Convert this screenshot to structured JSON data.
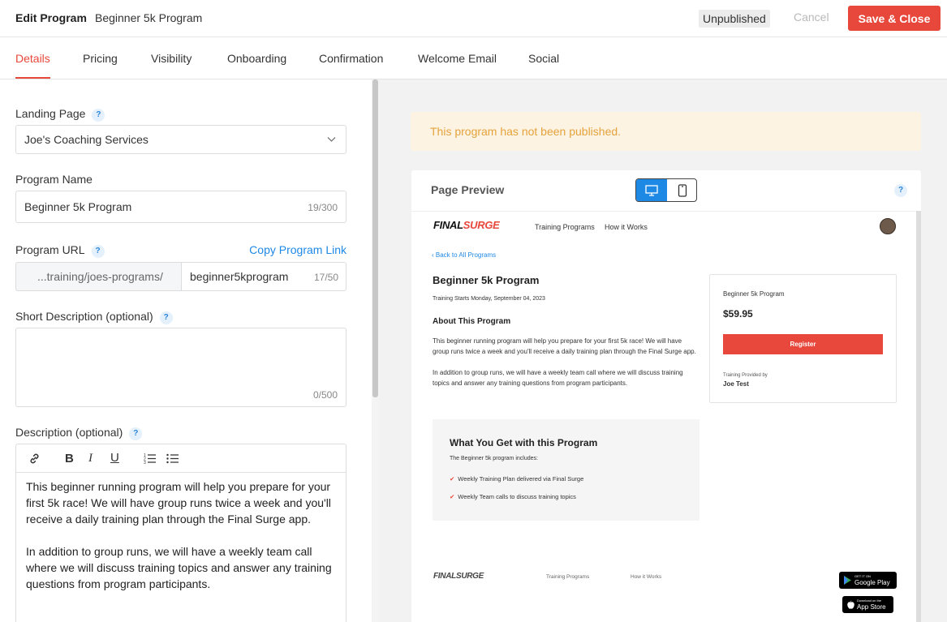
{
  "header": {
    "title": "Edit Program",
    "subtitle": "Beginner 5k Program",
    "status": "Unpublished",
    "cancel_label": "Cancel",
    "save_label": "Save & Close"
  },
  "tabs": [
    {
      "label": "Details",
      "active": true
    },
    {
      "label": "Pricing"
    },
    {
      "label": "Visibility"
    },
    {
      "label": "Onboarding"
    },
    {
      "label": "Confirmation"
    },
    {
      "label": "Welcome Email"
    },
    {
      "label": "Social"
    }
  ],
  "form": {
    "landing_page": {
      "label": "Landing Page",
      "value": "Joe's Coaching Services"
    },
    "program_name": {
      "label": "Program Name",
      "value": "Beginner 5k Program",
      "counter": "19/300"
    },
    "program_url": {
      "label": "Program URL",
      "copy_link": "Copy Program Link",
      "prefix": "...training/joes-programs/",
      "value": "beginner5kprogram",
      "counter": "17/50"
    },
    "short_description": {
      "label": "Short Description (optional)",
      "value": "",
      "counter": "0/500"
    },
    "description": {
      "label": "Description (optional)",
      "paragraph1": "This beginner running program will help you prepare for your first 5k race!  We will have group runs twice a week and you'll receive a daily training plan through the Final Surge app.",
      "paragraph2": "In addition to group runs, we will have a weekly team call where we will discuss training topics and answer any training questions from program participants."
    },
    "help_glyph": "?"
  },
  "preview": {
    "notice": "This program has not been published.",
    "card_title": "Page Preview",
    "brand": {
      "prefix": "FINAL",
      "suffix": "SURGE"
    },
    "nav": [
      "Training Programs",
      "How it Works"
    ],
    "back_link": "Back to All Programs",
    "program_title": "Beginner 5k Program",
    "start": "Training Starts Monday, September 04, 2023",
    "about_heading": "About This Program",
    "about_p1": "This beginner running program will help you prepare for your first 5k race! We will have group runs twice a week and you'll receive a daily training plan through the Final Surge app.",
    "about_p2": "In addition to group runs, we will have a weekly team call where we will discuss training topics and answer any training questions from program participants.",
    "sidebar": {
      "name": "Beginner 5k Program",
      "price": "$59.95",
      "register": "Register",
      "provided_label": "Training Provided by",
      "provider": "Joe Test"
    },
    "what_heading": "What You Get with this Program",
    "what_intro": "The Beginner 5k program includes:",
    "what_items": [
      "Weekly Training Plan delivered via Final Surge",
      "Weekly Team calls to discuss training topics"
    ],
    "footer_nav": [
      "Training Programs",
      "How it Works"
    ],
    "badges": {
      "google": {
        "small": "GET IT ON",
        "big": "Google Play"
      },
      "apple": {
        "small": "Download on the",
        "big": "App Store"
      }
    }
  },
  "colors": {
    "accent": "#e8473b",
    "link": "#1e88e5",
    "notice_text": "#e6a23c",
    "notice_bg": "#fcf3e2"
  }
}
